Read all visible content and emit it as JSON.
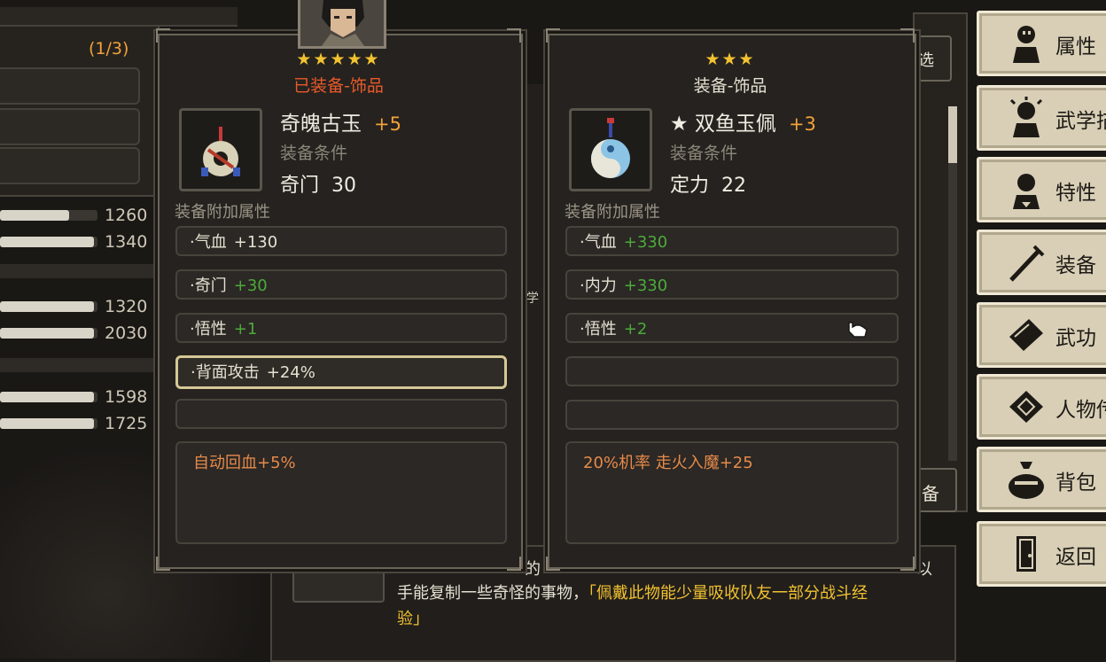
{
  "background": {
    "counter": "(1/3)",
    "stats": [
      "1260",
      "1340",
      "1320",
      "2030",
      "1598",
      "1725"
    ],
    "stat_fill_fractions": [
      0.74,
      1.0,
      1.0,
      1.0,
      1.0,
      1.0
    ],
    "bottom_text_line1_prefix": "手能复制一些奇怪的事物，",
    "bottom_text_line1_quote": "「佩戴此物能少量吸收队友一部分战斗经",
    "bottom_text_line2": "验」",
    "partial_label_xuan": "选",
    "partial_label_bei": "备",
    "partial_label_de": "的",
    "partial_label_yi": "以",
    "partial_label_xue": "学"
  },
  "equipped_card": {
    "stars": "★★★★★",
    "subtitle": "已装备-饰品",
    "item_name": "奇魄古玉",
    "enhance": "+5",
    "condition_label": "装备条件",
    "condition_value": "奇门  30",
    "section_label": "装备附加属性",
    "attributes": [
      {
        "name": "·气血",
        "value": "+130",
        "color": "white"
      },
      {
        "name": "·奇门",
        "value": "+30",
        "color": "green"
      },
      {
        "name": "·悟性",
        "value": "+1",
        "color": "green"
      },
      {
        "name": "·背面攻击",
        "value": "+24%",
        "color": "white"
      }
    ],
    "effect": "自动回血+5%"
  },
  "compare_card": {
    "stars": "★★★",
    "subtitle": "装备-饰品",
    "item_name": "★ 双鱼玉佩",
    "enhance": "+3",
    "condition_label": "装备条件",
    "condition_value": "定力  22",
    "section_label": "装备附加属性",
    "attributes": [
      {
        "name": "·气血",
        "value": "+330",
        "color": "green"
      },
      {
        "name": "·内力",
        "value": "+330",
        "color": "green"
      },
      {
        "name": "·悟性",
        "value": "+2",
        "color": "green"
      }
    ],
    "effect": "20%机率 走火入魔+25"
  },
  "menu": {
    "items": [
      {
        "label": "属性",
        "icon": "character-icon"
      },
      {
        "label": "武学描",
        "icon": "martial-figure-icon"
      },
      {
        "label": "特性",
        "icon": "trait-figure-icon"
      },
      {
        "label": "装备",
        "icon": "sword-icon"
      },
      {
        "label": "武功",
        "icon": "book-icon"
      },
      {
        "label": "人物传",
        "icon": "scroll-icon"
      },
      {
        "label": "背包",
        "icon": "bag-icon"
      },
      {
        "label": "返回",
        "icon": "door-icon"
      }
    ]
  },
  "colors": {
    "gold": "#f2c230",
    "equipped_red": "#e85a2a",
    "green_stat": "#4caa3a",
    "effect_orange": "#e68a4a",
    "menu_bg": "#d8cfb6"
  }
}
